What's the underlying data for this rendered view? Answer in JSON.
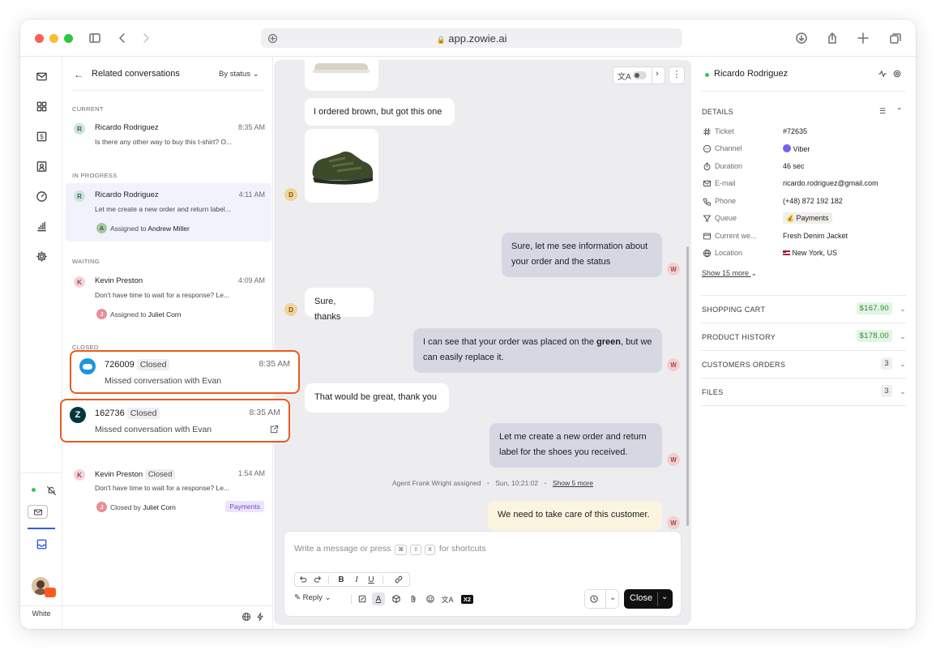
{
  "browser": {
    "url": "app.zowie.ai",
    "traffic_colors": [
      "#fe5f57",
      "#febc2e",
      "#28c840"
    ]
  },
  "rail": {
    "bottom_label": "White",
    "status_dot_color": "#34c759"
  },
  "list": {
    "back_label": "Related conversations",
    "sort_label": "By status",
    "sections": {
      "current": "CURRENT",
      "in_progress": "IN PROGRESS",
      "waiting": "WAITING",
      "closed": "CLOSED"
    },
    "current": {
      "initial": "R",
      "name": "Ricardo Rodriguez",
      "time": "8:35 AM",
      "preview": "Is there any other way to buy this t-shirt? O..."
    },
    "in_progress": {
      "initial": "R",
      "name": "Ricardo Rodriguez",
      "time": "4:11 AM",
      "preview": "Let me create a new order and return label...",
      "assign_initial": "A",
      "assign_prefix": "Assigned to",
      "assign_name": "Andrew Miller"
    },
    "waiting": {
      "initial": "K",
      "name": "Kevin Preston",
      "time": "4:09 AM",
      "preview": "Don't have time to wait for a response? Le...",
      "assign_initial": "J",
      "assign_prefix": "Assigned to",
      "assign_name": "Juliet Corn"
    },
    "closed_sf": {
      "id": "726009",
      "status": "Closed",
      "time": "8:35 AM",
      "preview": "Missed conversation with Evan"
    },
    "closed_zd": {
      "id": "162736",
      "status": "Closed",
      "time": "8:35 AM",
      "preview": "Missed conversation with Evan"
    },
    "closed_kp": {
      "initial": "K",
      "name": "Kevin Preston",
      "status": "Closed",
      "time": "1:54 AM",
      "preview": "Don't have time to wait for a response? Le...",
      "closed_initial": "J",
      "closed_prefix": "Closed by",
      "closed_name": "Juliet Corn",
      "tag": "Payments"
    }
  },
  "chat": {
    "messages": [
      {
        "text": "I ordered brown, but got this one"
      },
      {
        "avatar": "D"
      },
      {
        "text": "Sure, let me see information about your order and the status",
        "avatar": "W"
      },
      {
        "text": "Sure, thanks",
        "avatar": "D"
      },
      {
        "text_before": "I can see that your order was placed on the ",
        "text_bold": "green",
        "text_after": ", but we can easily replace it.",
        "avatar": "W"
      },
      {
        "text": "That would be great, thank you"
      },
      {
        "text": "Let me create a new order and return label for the shoes you received.",
        "avatar": "W"
      },
      {
        "text": "We need to take care of this customer.",
        "avatar": "W"
      }
    ],
    "system": {
      "assigned": "Agent Frank Wright assigned",
      "date": "Sun, 10:21:02",
      "more": "Show 5 more"
    },
    "composer": {
      "placeholder": "Write a message or press",
      "keys": [
        "⌘",
        "⇧",
        "X"
      ],
      "suffix": "for shortcuts",
      "reply_label": "Reply",
      "close_label": "Close",
      "x2_label": "X2"
    }
  },
  "details": {
    "customer_name": "Ricardo Rodriguez",
    "section_title": "DETAILS",
    "rows": [
      {
        "label": "Ticket",
        "value": "#72635",
        "icon": "hash-icon"
      },
      {
        "label": "Channel",
        "value": "Viber",
        "icon": "chat-bubble-icon"
      },
      {
        "label": "Duration",
        "value": "46 sec",
        "icon": "stopwatch-icon"
      },
      {
        "label": "E-mail",
        "value": "ricardo.rodriguez@gmail.com",
        "icon": "mail-icon"
      },
      {
        "label": "Phone",
        "value": "(+48) 872 192 182",
        "icon": "phone-icon"
      },
      {
        "label": "Queue",
        "value": "Payments",
        "icon": "filter-icon"
      },
      {
        "label": "Current we...",
        "value": "Fresh Denim Jacket",
        "icon": "browser-icon"
      },
      {
        "label": "Location",
        "value": "New York, US",
        "icon": "globe-icon"
      }
    ],
    "show_more": "Show 15 more",
    "accordions": [
      {
        "label": "SHOPPING CART",
        "badge": "$167.90",
        "badge_type": "green"
      },
      {
        "label": "PRODUCT HISTORY",
        "badge": "$178.00",
        "badge_type": "green"
      },
      {
        "label": "CUSTOMERS ORDERS",
        "badge": "3",
        "badge_type": "gray"
      },
      {
        "label": "FILES",
        "badge": "3",
        "badge_type": "gray"
      }
    ]
  }
}
